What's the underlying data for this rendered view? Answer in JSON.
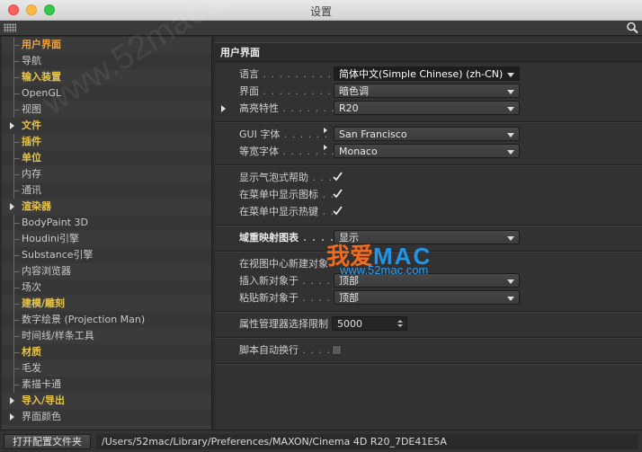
{
  "window": {
    "title": "设置"
  },
  "sidebar": {
    "items": [
      {
        "label": "用户界面",
        "style": "active",
        "arrow": false
      },
      {
        "label": "导航",
        "style": "normal",
        "arrow": false
      },
      {
        "label": "输入装置",
        "style": "bold",
        "arrow": false
      },
      {
        "label": "OpenGL",
        "style": "normal",
        "arrow": false
      },
      {
        "label": "视图",
        "style": "normal",
        "arrow": false
      },
      {
        "label": "文件",
        "style": "bold",
        "arrow": true
      },
      {
        "label": "插件",
        "style": "bold",
        "arrow": false
      },
      {
        "label": "单位",
        "style": "bold",
        "arrow": false
      },
      {
        "label": "内存",
        "style": "normal",
        "arrow": false
      },
      {
        "label": "通讯",
        "style": "normal",
        "arrow": false
      },
      {
        "label": "渲染器",
        "style": "bold",
        "arrow": true
      },
      {
        "label": "BodyPaint 3D",
        "style": "normal",
        "arrow": false
      },
      {
        "label": "Houdini引擎",
        "style": "normal",
        "arrow": false
      },
      {
        "label": "Substance引擎",
        "style": "normal",
        "arrow": false
      },
      {
        "label": "内容浏览器",
        "style": "normal",
        "arrow": false
      },
      {
        "label": "场次",
        "style": "normal",
        "arrow": false
      },
      {
        "label": "建模/雕刻",
        "style": "bold",
        "arrow": false
      },
      {
        "label": "数字绘景 (Projection Man)",
        "style": "normal",
        "arrow": false
      },
      {
        "label": "时间线/样条工具",
        "style": "normal",
        "arrow": false
      },
      {
        "label": "材质",
        "style": "bold",
        "arrow": false
      },
      {
        "label": "毛发",
        "style": "normal",
        "arrow": false
      },
      {
        "label": "素描卡通",
        "style": "normal",
        "arrow": false
      },
      {
        "label": "导入/导出",
        "style": "bold",
        "arrow": true
      },
      {
        "label": "界面颜色",
        "style": "normal",
        "arrow": true
      }
    ]
  },
  "main": {
    "section_title": "用户界面",
    "language": {
      "label": "语言",
      "dots": " . . . . . . . . . . . .",
      "value": "简体中文(Simple Chinese) (zh-CN)"
    },
    "interface": {
      "label": "界面",
      "dots": " . . . . . . . . . . . .",
      "value": "暗色调"
    },
    "highlight": {
      "label": "高亮特性",
      "dots": " . . . . . . . . . .",
      "value": "R20"
    },
    "gui_font": {
      "label": "GUI 字体",
      "dots": " . . . . . . .",
      "value": "San Francisco"
    },
    "mono_font": {
      "label": "等宽字体",
      "dots": " . . . . . . .",
      "value": "Monaco"
    },
    "bubble_help": {
      "label": "显示气泡式帮助",
      "dots": " . . .",
      "checked": true
    },
    "menu_icons": {
      "label": "在菜单中显示图标",
      "dots": " . .",
      "checked": true
    },
    "menu_hotkeys": {
      "label": "在菜单中显示热键",
      "dots": " . .",
      "checked": true
    },
    "region_map": {
      "label": "域重映射图表",
      "dots": " . . . . . . .",
      "value": "显示"
    },
    "view_center": {
      "label": "在视图中心新建对象"
    },
    "insert_new": {
      "label": "插入新对象于",
      "dots": " . . . . . .",
      "value": "顶部"
    },
    "paste_new": {
      "label": "粘贴新对象于",
      "dots": " . . . . . .",
      "value": "顶部"
    },
    "attr_limit": {
      "label": "属性管理器选择限制",
      "value": "5000"
    },
    "script_wrap": {
      "label": "脚本自动换行",
      "dots": " . . . . .",
      "checked": false
    }
  },
  "watermark": {
    "diag": "www.52mac.com",
    "logo_cn": "我爱",
    "logo_en": "MAC",
    "url": "www.52mac.com"
  },
  "bottom": {
    "open_button": "打开配置文件夹",
    "path": "/Users/52mac/Library/Preferences/MAXON/Cinema 4D R20_7DE41E5A"
  }
}
